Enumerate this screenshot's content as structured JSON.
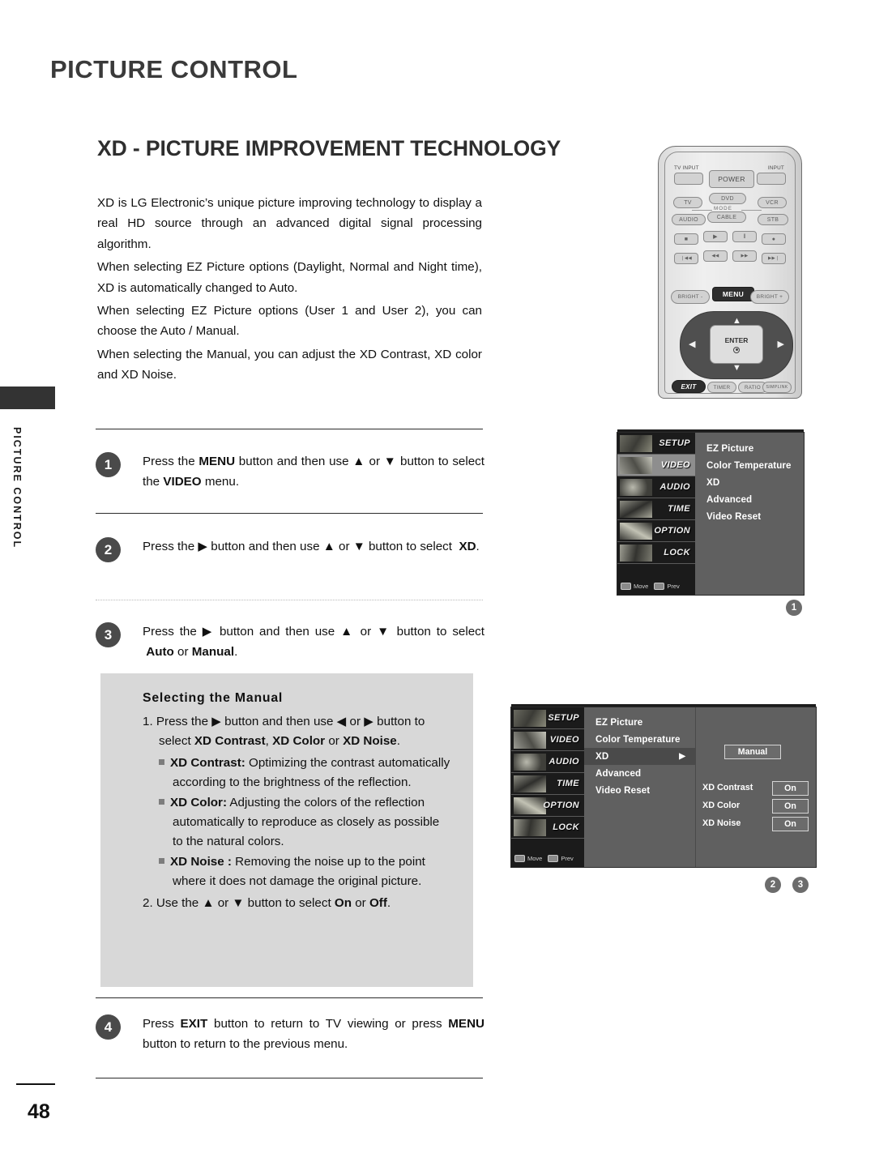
{
  "chapter_title": "PICTURE CONTROL",
  "section_title": "XD - PICTURE IMPROVEMENT TECHNOLOGY",
  "side_tab_label": "PICTURE CONTROL",
  "page_number": "48",
  "intro": {
    "p1": "XD is LG Electronic’s unique picture improving technology to display a real HD source through an advanced digital signal processing algorithm.",
    "p2": "When selecting EZ Picture options (Daylight, Normal and Night time), XD is automatically changed to Auto.",
    "p3": "When selecting EZ Picture options (User 1 and User 2), you can choose the Auto / Manual.",
    "p4": "When selecting the Manual, you can adjust the XD Contrast, XD color and XD Noise."
  },
  "steps": [
    {
      "num": "1",
      "html": "Press the <b>MENU</b> button and then use ▲ or ▼ button to select the <b>VIDEO</b> menu."
    },
    {
      "num": "2",
      "html": "Press the ▶ button and then use ▲ or ▼ button to select <b>&nbsp;XD</b>."
    },
    {
      "num": "3",
      "html": "Press the ▶ button and then use ▲ or ▼ button to select <b>&nbsp;Auto</b> or <b>Manual</b>."
    },
    {
      "num": "4",
      "html": "Press <b>EXIT</b> button to return to TV viewing or press <b>MENU</b> button to return to the previous menu."
    }
  ],
  "callout": {
    "title": "Selecting the Manual",
    "item1": "1. Press the ▶ button and then use ◀ or ▶ button to select <b>XD&nbsp;Contrast</b>, <b>XD&nbsp;Color</b> or <b>XD&nbsp;Noise</b>.",
    "bullets": [
      "<b>XD&nbsp;Contrast:</b> Optimizing the contrast automatically according to the brightness of the reflection.",
      "<b>XD&nbsp;Color:</b> Adjusting the colors of the reflection automatically to reproduce as closely as possible to the natural colors.",
      "<b>XD&nbsp;Noise :</b> Removing the noise up to the point where it does not damage the original picture."
    ],
    "item2": "2. Use the ▲ or ▼ button to select <b>On</b> or <b>Off</b>."
  },
  "remote": {
    "labels": {
      "tv_input": "TV INPUT",
      "input": "INPUT",
      "mode": "MODE"
    },
    "keys": {
      "power": "POWER",
      "tv": "TV",
      "dvd": "DVD",
      "vcr": "VCR",
      "audio": "AUDIO",
      "cable": "CABLE",
      "stb": "STB",
      "stop": "■",
      "play": "▶",
      "pause": "‖",
      "record": "●",
      "skip_back": "❘◀◀",
      "rewind": "◀◀",
      "forward": "▶▶",
      "skip_fwd": "▶▶❘",
      "bright_minus": "BRIGHT -",
      "menu": "MENU",
      "bright_plus": "BRIGHT +",
      "enter": "ENTER",
      "up": "▲",
      "down": "▼",
      "left": "◀",
      "right": "▶",
      "exit": "EXIT",
      "timer": "TIMER",
      "ratio": "RATIO",
      "simplink": "SIMPLINK"
    }
  },
  "osd": {
    "categories": [
      "SETUP",
      "VIDEO",
      "AUDIO",
      "TIME",
      "OPTION",
      "LOCK"
    ],
    "nav": {
      "move": "Move",
      "prev": "Prev"
    },
    "video_menu_items": [
      "EZ Picture",
      "Color Temperature",
      "XD",
      "Advanced",
      "Video Reset"
    ],
    "screen1": {
      "selected_category": "VIDEO",
      "badge": "1"
    },
    "screen2": {
      "selected_category": "VIDEO",
      "highlighted_item": "XD",
      "caret": "▶",
      "mode_button": "Manual",
      "fields": [
        {
          "label": "XD Contrast",
          "value": "On"
        },
        {
          "label": "XD Color",
          "value": "On"
        },
        {
          "label": "XD Noise",
          "value": "On"
        }
      ],
      "badges": [
        "2",
        "3"
      ]
    }
  }
}
